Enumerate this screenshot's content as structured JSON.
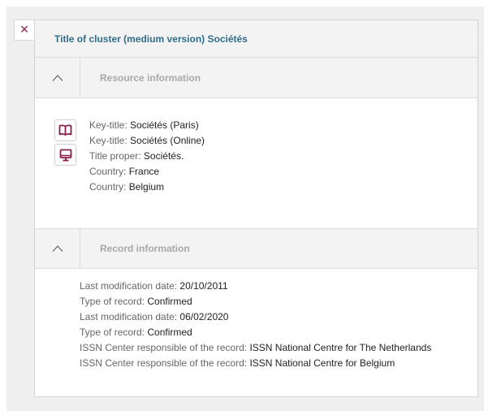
{
  "panel": {
    "close_symbol": "×",
    "title": "Title of cluster (medium version) Sociétés"
  },
  "colors": {
    "title": "#2e6e8c",
    "icon_accent": "#8b1d4a",
    "section_title": "#a8a8a8"
  },
  "resource": {
    "section_title": "Resource information",
    "icons": [
      "book-icon",
      "monitor-icon"
    ],
    "lines": [
      {
        "label": "Key-title: ",
        "value": "Sociétés (Paris)"
      },
      {
        "label": "Key-title: ",
        "value": "Sociétés (Online)"
      },
      {
        "label": "Title proper: ",
        "value": "Sociétés."
      },
      {
        "label": "Country: ",
        "value": "France"
      },
      {
        "label": "Country: ",
        "value": "Belgium"
      }
    ]
  },
  "record": {
    "section_title": "Record information",
    "lines": [
      {
        "label": "Last modification date: ",
        "value": "20/10/2011"
      },
      {
        "label": "Type of record: ",
        "value": "Confirmed"
      },
      {
        "label": "Last modification date: ",
        "value": "06/02/2020"
      },
      {
        "label": "Type of record: ",
        "value": "Confirmed"
      },
      {
        "label": "ISSN Center responsible of the record: ",
        "value": "ISSN National Centre for The Netherlands"
      },
      {
        "label": "ISSN Center responsible of the record: ",
        "value": "ISSN National Centre for Belgium"
      }
    ]
  }
}
